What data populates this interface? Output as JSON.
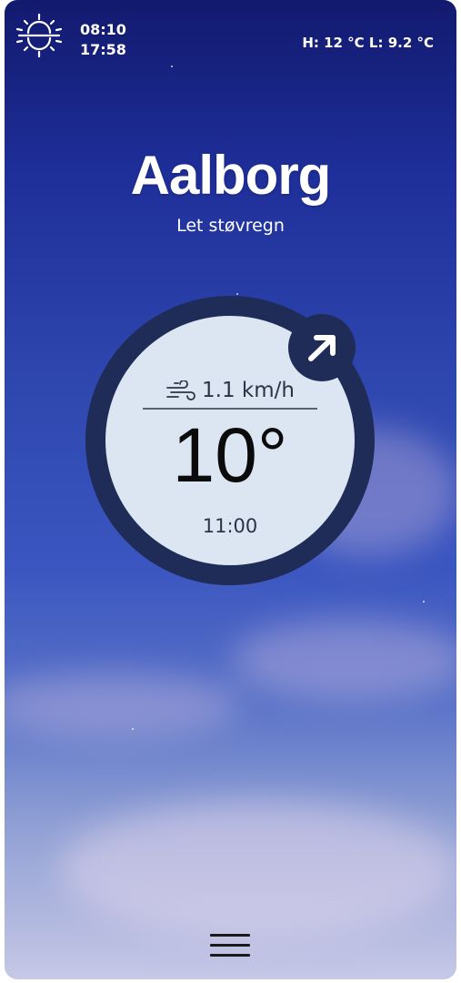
{
  "header": {
    "sun_icon": "sunrise-sunset-icon",
    "sunrise": "08:10",
    "sunset": "17:58",
    "high_low": "H: 12 °C L: 9.2 °C"
  },
  "location": {
    "city": "Aalborg",
    "description": "Let støvregn"
  },
  "dial": {
    "wind_icon": "wind-icon",
    "wind_speed": "1.1 km/h",
    "temperature": "10°",
    "time": "11:00",
    "direction_icon": "arrow-up-right-icon"
  },
  "footer": {
    "menu_icon": "hamburger-menu-icon"
  },
  "colors": {
    "dial_ring": "#1f2c57",
    "dial_face": "#dce6f3",
    "sky_top": "#121a6e",
    "sky_bottom": "#c6c8e6"
  }
}
